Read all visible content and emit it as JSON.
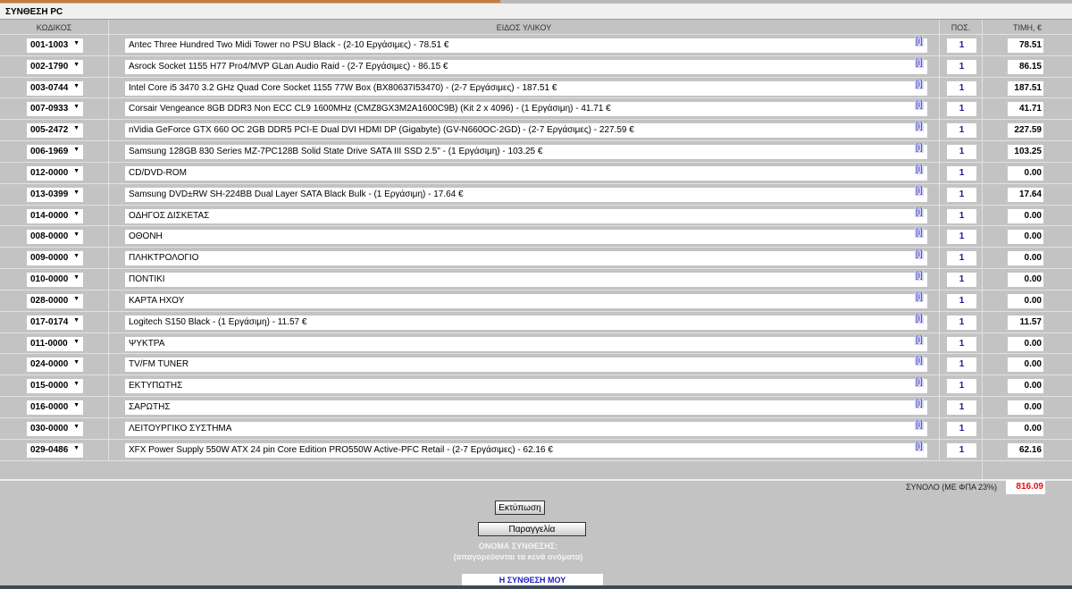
{
  "title": "ΣΥΝΘΕΣΗ PC",
  "headers": {
    "code": "ΚΩΔΙΚΟΣ",
    "desc": "ΕΙΔΟΣ ΥΛΙΚΟΥ",
    "qty": "ΠΟΣ.",
    "price": "ΤΙΜΗ, €"
  },
  "info_label": "[i]",
  "rows": [
    {
      "code": "001-1003",
      "desc": "Antec Three Hundred Two Midi Tower no PSU Black - (2-10 Εργάσιμες) - 78.51 €",
      "qty": "1",
      "price": "78.51"
    },
    {
      "code": "002-1790",
      "desc": "Asrock Socket 1155 H77 Pro4/MVP GLan Audio Raid - (2-7 Εργάσιμες) - 86.15 €",
      "qty": "1",
      "price": "86.15"
    },
    {
      "code": "003-0744",
      "desc": "Intel Core i5 3470 3.2 GHz Quad Core Socket 1155 77W Box (BX80637I53470) - (2-7 Εργάσιμες) - 187.51 €",
      "qty": "1",
      "price": "187.51"
    },
    {
      "code": "007-0933",
      "desc": "Corsair Vengeance 8GB DDR3 Non ECC CL9 1600MHz (CMZ8GX3M2A1600C9B) (Kit 2 x 4096) - (1 Εργάσιμη) - 41.71 €",
      "qty": "1",
      "price": "41.71"
    },
    {
      "code": "005-2472",
      "desc": "nVidia GeForce GTX 660 OC 2GB DDR5 PCI-E Dual DVI HDMI DP (Gigabyte) (GV-N660OC-2GD) - (2-7 Εργάσιμες) - 227.59 €",
      "qty": "1",
      "price": "227.59"
    },
    {
      "code": "006-1969",
      "desc": "Samsung 128GB 830 Series MZ-7PC128B Solid State Drive SATA III SSD 2.5\" - (1 Εργάσιμη) - 103.25 €",
      "qty": "1",
      "price": "103.25"
    },
    {
      "code": "012-0000",
      "desc": "CD/DVD-ROM",
      "qty": "1",
      "price": "0.00"
    },
    {
      "code": "013-0399",
      "desc": "Samsung DVD±RW SH-224BB Dual Layer SATA Black Bulk - (1 Εργάσιμη) - 17.64 €",
      "qty": "1",
      "price": "17.64"
    },
    {
      "code": "014-0000",
      "desc": "ΟΔΗΓΟΣ ΔΙΣΚΕΤΑΣ",
      "qty": "1",
      "price": "0.00"
    },
    {
      "code": "008-0000",
      "desc": "ΟΘΟΝΗ",
      "qty": "1",
      "price": "0.00"
    },
    {
      "code": "009-0000",
      "desc": "ΠΛΗΚΤΡΟΛΟΓΙΟ",
      "qty": "1",
      "price": "0.00"
    },
    {
      "code": "010-0000",
      "desc": "ΠΟΝΤΙΚΙ",
      "qty": "1",
      "price": "0.00"
    },
    {
      "code": "028-0000",
      "desc": "ΚΑΡΤΑ ΗΧΟΥ",
      "qty": "1",
      "price": "0.00"
    },
    {
      "code": "017-0174",
      "desc": "Logitech S150 Black - (1 Εργάσιμη) - 11.57 €",
      "qty": "1",
      "price": "11.57"
    },
    {
      "code": "011-0000",
      "desc": "ΨΥΚΤΡΑ",
      "qty": "1",
      "price": "0.00"
    },
    {
      "code": "024-0000",
      "desc": "TV/FM TUNER",
      "qty": "1",
      "price": "0.00"
    },
    {
      "code": "015-0000",
      "desc": "ΕΚΤΥΠΩΤΗΣ",
      "qty": "1",
      "price": "0.00"
    },
    {
      "code": "016-0000",
      "desc": "ΣΑΡΩΤΗΣ",
      "qty": "1",
      "price": "0.00"
    },
    {
      "code": "030-0000",
      "desc": "ΛΕΙΤΟΥΡΓΙΚΟ ΣΥΣΤΗΜΑ",
      "qty": "1",
      "price": "0.00"
    },
    {
      "code": "029-0486",
      "desc": "XFX Power Supply 550W ATX 24 pin Core Edition PRO550W Active-PFC Retail - (2-7 Εργάσιμες) - 62.16 €",
      "qty": "1",
      "price": "62.16"
    }
  ],
  "total": {
    "label": "ΣΥΝΟΛΟ (ΜΕ ΦΠΑ 23%)",
    "value": "816.09"
  },
  "buttons": {
    "print": "Εκτύπωση",
    "order": "Παραγγελία"
  },
  "name_section": {
    "label": "ΟΝΟΜΑ ΣΥΝΘΕΣΗΣ:",
    "hint": "(απαγορεύονται τα κενά ονόματα)",
    "value": "Η ΣΥΝΘΕΣΗ ΜΟΥ"
  }
}
